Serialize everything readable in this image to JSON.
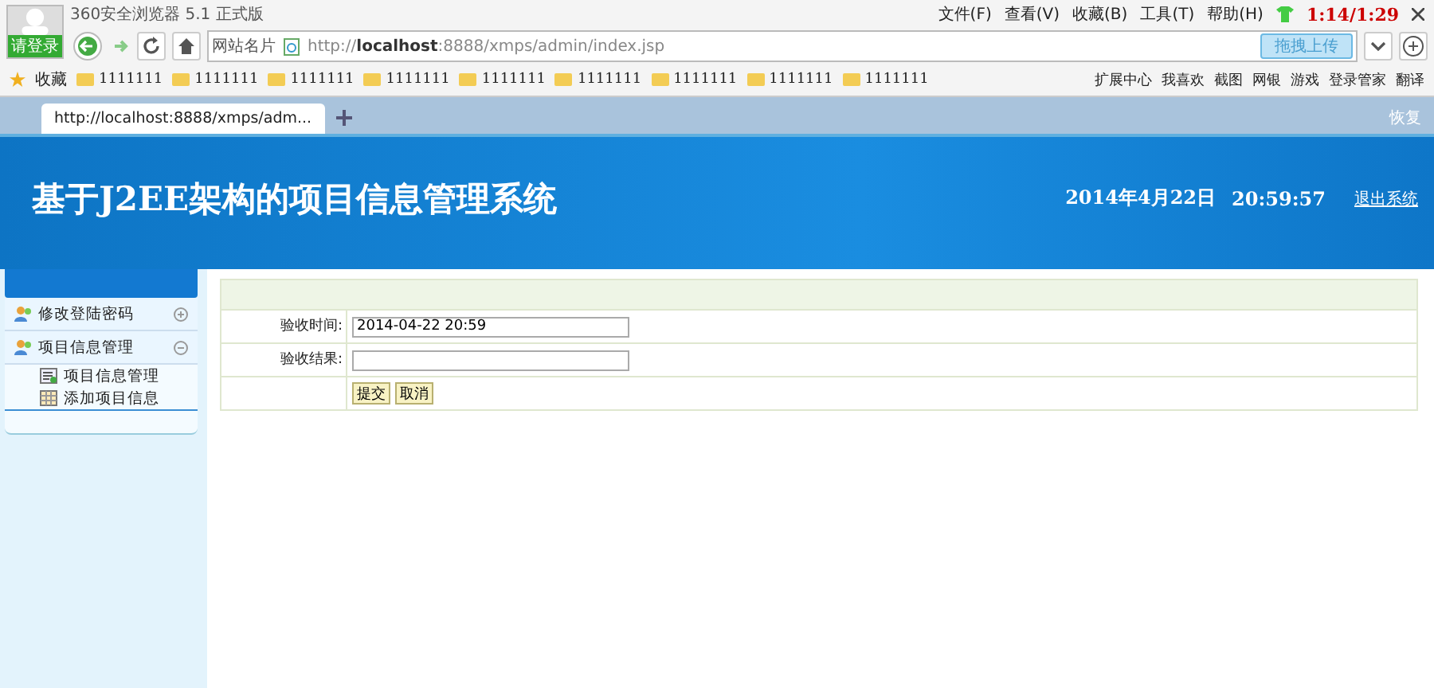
{
  "browser": {
    "title": "360安全浏览器 5.1 正式版",
    "login": "请登录",
    "menu": [
      "文件(F)",
      "查看(V)",
      "收藏(B)",
      "工具(T)",
      "帮助(H)"
    ],
    "overlay_time": "1:14/1:29",
    "site_card": "网站名片",
    "url_prefix": "http://",
    "url_host": "localhost",
    "url_rest": ":8888/xmps/admin/index.jsp",
    "upload": "拖拽上传",
    "favorites": "收藏",
    "bookmarks": [
      "1111111",
      "1111111",
      "1111111",
      "1111111",
      "1111111",
      "1111111",
      "1111111",
      "1111111",
      "1111111"
    ],
    "tools": [
      "扩展中心",
      "我喜欢",
      "截图",
      "网银",
      "游戏",
      "登录管家",
      "翻译"
    ],
    "tab": "http://localhost:8888/xmps/adm...",
    "restore": "恢复"
  },
  "header": {
    "title": "基于J2EE架构的项目信息管理系统",
    "date": "2014年4月22日",
    "time": "20:59:57",
    "logout": "退出系统"
  },
  "sidebar": {
    "items": [
      {
        "label": "修改登陆密码",
        "expanded": false
      },
      {
        "label": "项目信息管理",
        "expanded": true,
        "children": [
          {
            "label": "项目信息管理",
            "kind": "list"
          },
          {
            "label": "添加项目信息",
            "kind": "table"
          }
        ]
      }
    ]
  },
  "form": {
    "fields": [
      {
        "label": "验收时间:",
        "value": "2014-04-22 20:59"
      },
      {
        "label": "验收结果:"
      }
    ],
    "buttons": [
      "提交",
      "取消"
    ]
  }
}
